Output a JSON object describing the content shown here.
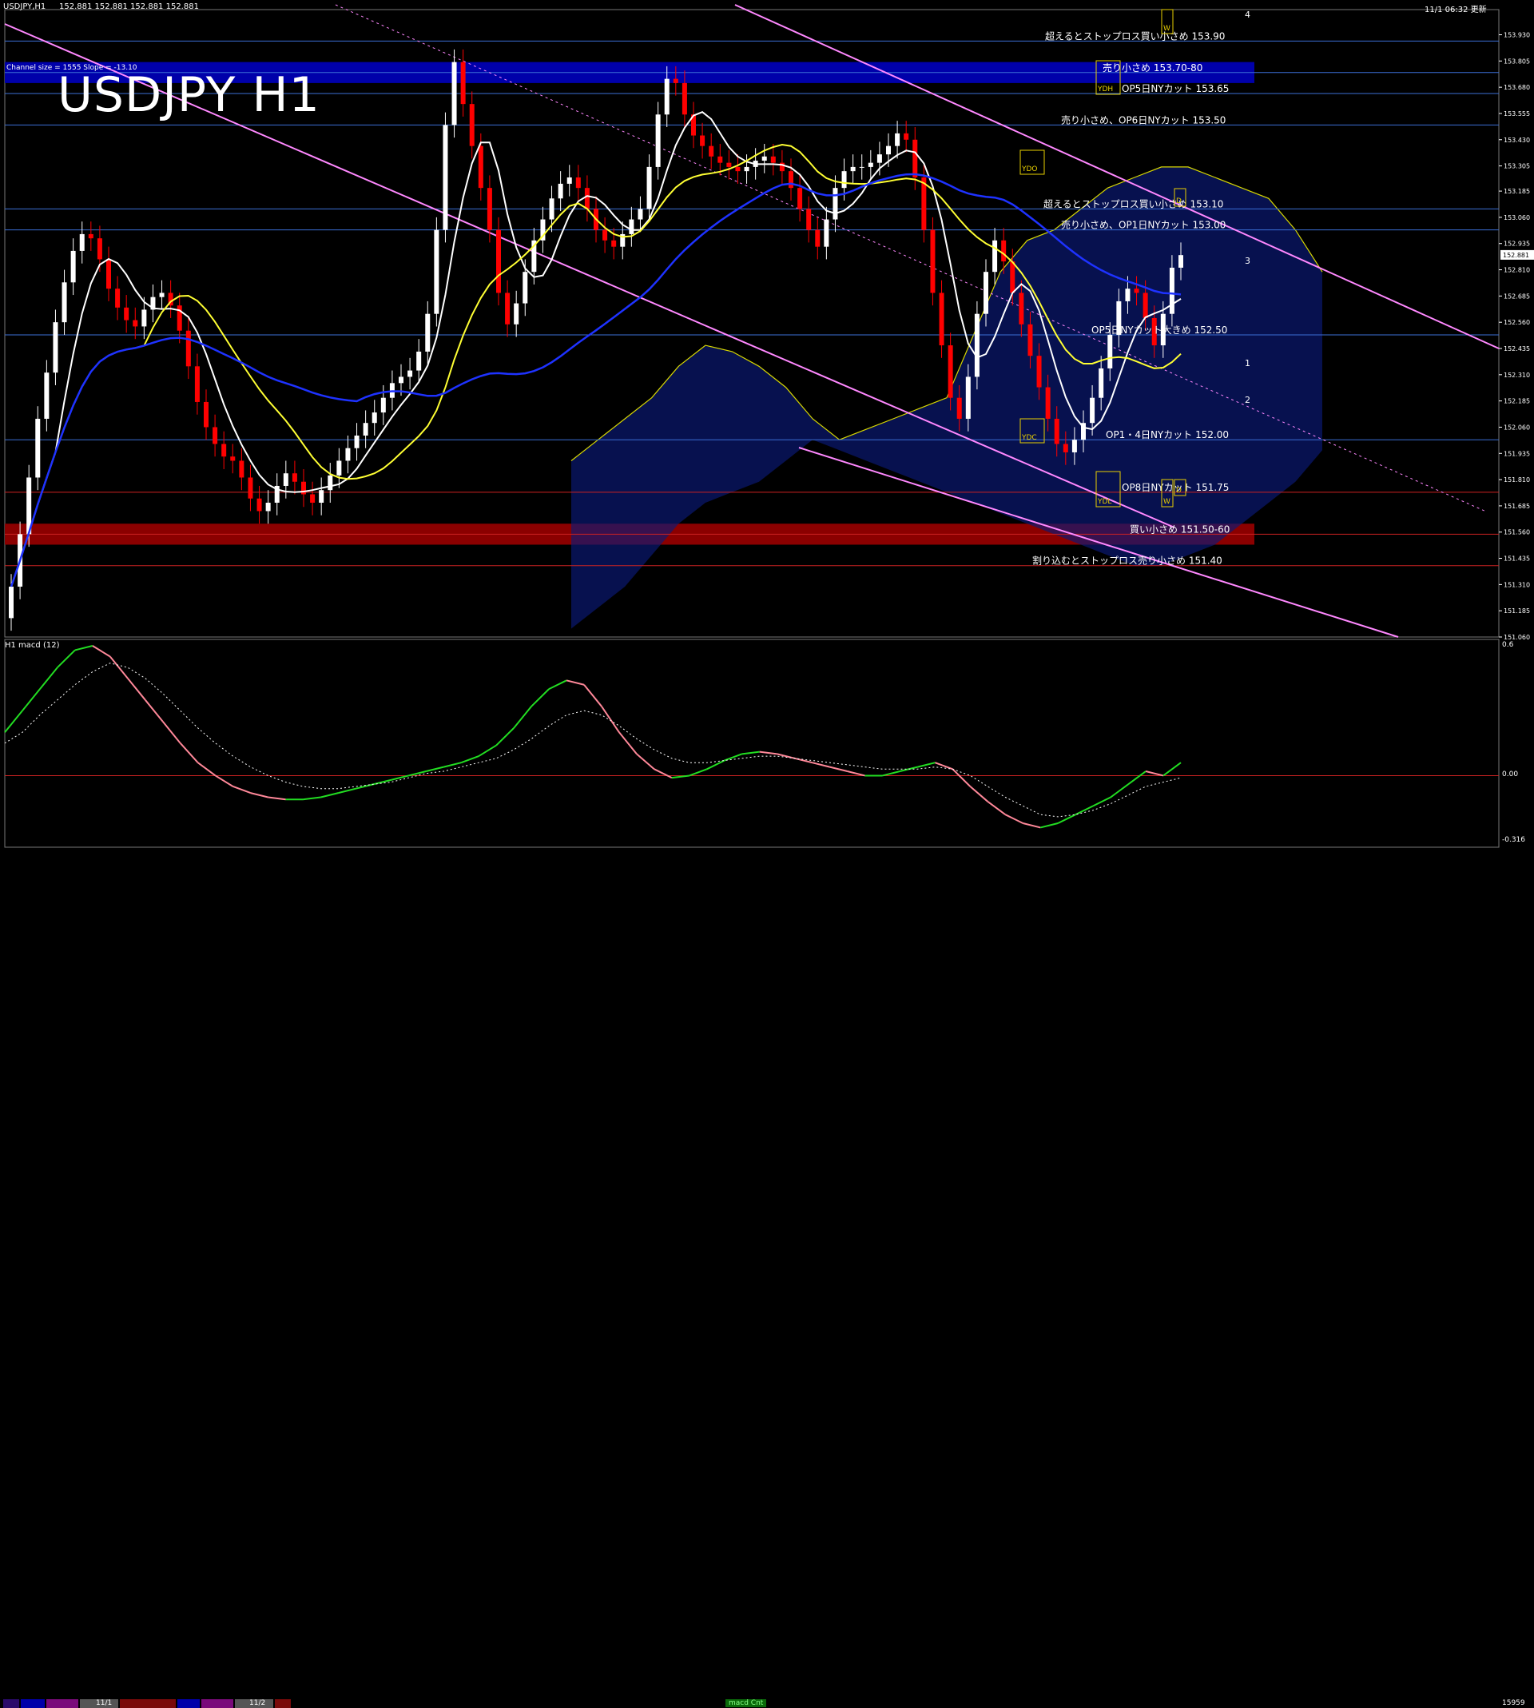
{
  "header": {
    "symbol_info": "USDJPY,H1",
    "ohlc": "152.881 152.881 152.881 152.881",
    "datetime": "11/1 06:32 更新",
    "channel_info": "Channel size = 1555 Slope = -13.10",
    "big_title": "USDJPY H1"
  },
  "subwindow": {
    "label": "H1 macd (12)",
    "top_value": "0.6",
    "zero_value": "0.00",
    "bottom_value": "-0.316",
    "bottom_right": "15959"
  },
  "bottom_bar": {
    "date_labels": [
      "11/1",
      "11/2"
    ],
    "center_label": "macd Cnt"
  },
  "colors": {
    "background": "#000000",
    "bull": "#ffffff",
    "bear": "#ff0000",
    "axis": "#ffffff",
    "blue_zone": "#0000aa",
    "red_zone": "#8b0000",
    "hline": "#3b6fd6",
    "channel": "#ff88ff"
  },
  "chart_data": [
    {
      "type": "candlestick",
      "title": "USDJPY H1",
      "ylim": [
        151.06,
        154.05
      ],
      "y_ticks": [
        "153.930",
        "153.805",
        "153.680",
        "153.555",
        "153.430",
        "153.305",
        "153.185",
        "153.060",
        "152.935",
        "152.810",
        "152.685",
        "152.560",
        "152.435",
        "152.310",
        "152.185",
        "152.060",
        "151.935",
        "151.810",
        "151.685",
        "151.560",
        "151.435",
        "151.310",
        "151.185",
        "151.060"
      ],
      "current_price": "152.881",
      "closes": [
        151.3,
        151.55,
        151.82,
        152.1,
        152.32,
        152.56,
        152.75,
        152.9,
        152.98,
        152.96,
        152.86,
        152.72,
        152.63,
        152.57,
        152.54,
        152.62,
        152.68,
        152.7,
        152.64,
        152.52,
        152.35,
        152.18,
        152.06,
        151.98,
        151.92,
        151.9,
        151.82,
        151.72,
        151.66,
        151.7,
        151.78,
        151.84,
        151.8,
        151.74,
        151.7,
        151.76,
        151.83,
        151.9,
        151.96,
        152.02,
        152.08,
        152.13,
        152.2,
        152.27,
        152.3,
        152.33,
        152.42,
        152.6,
        153.0,
        153.5,
        153.8,
        153.6,
        153.4,
        153.2,
        153.0,
        152.7,
        152.55,
        152.65,
        152.8,
        152.95,
        153.05,
        153.15,
        153.22,
        153.25,
        153.2,
        153.1,
        153.0,
        152.95,
        152.92,
        152.98,
        153.05,
        153.1,
        153.3,
        153.55,
        153.72,
        153.7,
        153.55,
        153.45,
        153.4,
        153.35,
        153.32,
        153.3,
        153.28,
        153.3,
        153.33,
        153.35,
        153.32,
        153.28,
        153.2,
        153.1,
        153.0,
        152.92,
        153.05,
        153.2,
        153.28,
        153.3,
        153.3,
        153.32,
        153.36,
        153.4,
        153.46,
        153.43,
        153.25,
        153.0,
        152.7,
        152.45,
        152.2,
        152.1,
        152.3,
        152.6,
        152.8,
        152.95,
        152.85,
        152.7,
        152.55,
        152.4,
        152.25,
        152.1,
        151.98,
        151.94,
        152.0,
        152.08,
        152.2,
        152.34,
        152.5,
        152.66,
        152.72,
        152.7,
        152.58,
        152.45,
        152.6,
        152.82,
        152.88
      ],
      "ichimoku_cloud_top": [
        151.9,
        152.0,
        152.1,
        152.2,
        152.35,
        152.45,
        152.42,
        152.35,
        152.25,
        152.1,
        152.0,
        152.05,
        152.1,
        152.15,
        152.2,
        152.5,
        152.8,
        152.95,
        153.0,
        153.1,
        153.2,
        153.25,
        153.3,
        153.3,
        153.25,
        153.2,
        153.15,
        153.0,
        152.8
      ],
      "ichimoku_cloud_bottom": [
        151.1,
        151.2,
        151.3,
        151.45,
        151.6,
        151.7,
        151.75,
        151.8,
        151.9,
        152.0,
        151.95,
        151.9,
        151.85,
        151.8,
        151.75,
        151.7,
        151.65,
        151.6,
        151.55,
        151.5,
        151.45,
        151.4,
        151.4,
        151.45,
        151.5,
        151.6,
        151.7,
        151.8,
        151.95
      ],
      "annotations": [
        {
          "text": "超えるとストップロス買い小さめ 153.90",
          "price": 153.9
        },
        {
          "text": "売り小さめ 153.70-80",
          "price": 153.75,
          "zone": "blue"
        },
        {
          "text": "OP5日NYカット 153.65",
          "price": 153.65
        },
        {
          "text": "売り小さめ、OP6日NYカット 153.50",
          "price": 153.5
        },
        {
          "text": "超えるとストップロス買い小さめ 153.10",
          "price": 153.1
        },
        {
          "text": "売り小さめ、OP1日NYカット 153.00",
          "price": 153.0
        },
        {
          "text": "OP5日NYカット大きめ 152.50",
          "price": 152.5
        },
        {
          "text": "OP1・4日NYカット 152.00",
          "price": 152.0
        },
        {
          "text": "OP8日NYカット 151.75",
          "price": 151.75
        },
        {
          "text": "買い小さめ 151.50-60",
          "price": 151.55,
          "zone": "red"
        },
        {
          "text": "割り込むとストップロス売り小さめ 151.40",
          "price": 151.4
        }
      ],
      "box_labels": [
        "YDH",
        "YDO",
        "YDC",
        "YDL",
        "W",
        "D",
        "W",
        "D"
      ],
      "projection_numbers": [
        "4",
        "3",
        "1",
        "2"
      ]
    },
    {
      "type": "line",
      "title": "H1 macd (12)",
      "ylim": [
        -0.316,
        0.6
      ],
      "macd": [
        0.2,
        0.3,
        0.4,
        0.5,
        0.58,
        0.6,
        0.55,
        0.45,
        0.35,
        0.25,
        0.15,
        0.06,
        0.0,
        -0.05,
        -0.08,
        -0.1,
        -0.11,
        -0.11,
        -0.1,
        -0.08,
        -0.06,
        -0.04,
        -0.02,
        0.0,
        0.02,
        0.04,
        0.06,
        0.09,
        0.14,
        0.22,
        0.32,
        0.4,
        0.44,
        0.42,
        0.32,
        0.2,
        0.1,
        0.03,
        -0.01,
        0.0,
        0.03,
        0.07,
        0.1,
        0.11,
        0.1,
        0.08,
        0.06,
        0.04,
        0.02,
        0.0,
        0.0,
        0.02,
        0.04,
        0.06,
        0.03,
        -0.05,
        -0.12,
        -0.18,
        -0.22,
        -0.24,
        -0.22,
        -0.18,
        -0.14,
        -0.1,
        -0.04,
        0.02,
        0.0,
        0.06
      ],
      "signal": [
        0.15,
        0.2,
        0.28,
        0.35,
        0.42,
        0.48,
        0.52,
        0.5,
        0.45,
        0.38,
        0.3,
        0.22,
        0.15,
        0.09,
        0.04,
        0.0,
        -0.03,
        -0.05,
        -0.06,
        -0.06,
        -0.05,
        -0.04,
        -0.03,
        -0.01,
        0.01,
        0.02,
        0.04,
        0.06,
        0.08,
        0.12,
        0.17,
        0.23,
        0.28,
        0.3,
        0.28,
        0.23,
        0.17,
        0.12,
        0.08,
        0.06,
        0.06,
        0.07,
        0.08,
        0.09,
        0.09,
        0.08,
        0.07,
        0.06,
        0.05,
        0.04,
        0.03,
        0.03,
        0.03,
        0.04,
        0.03,
        0.0,
        -0.05,
        -0.1,
        -0.14,
        -0.18,
        -0.19,
        -0.18,
        -0.16,
        -0.13,
        -0.09,
        -0.05,
        -0.03,
        -0.01
      ]
    }
  ]
}
